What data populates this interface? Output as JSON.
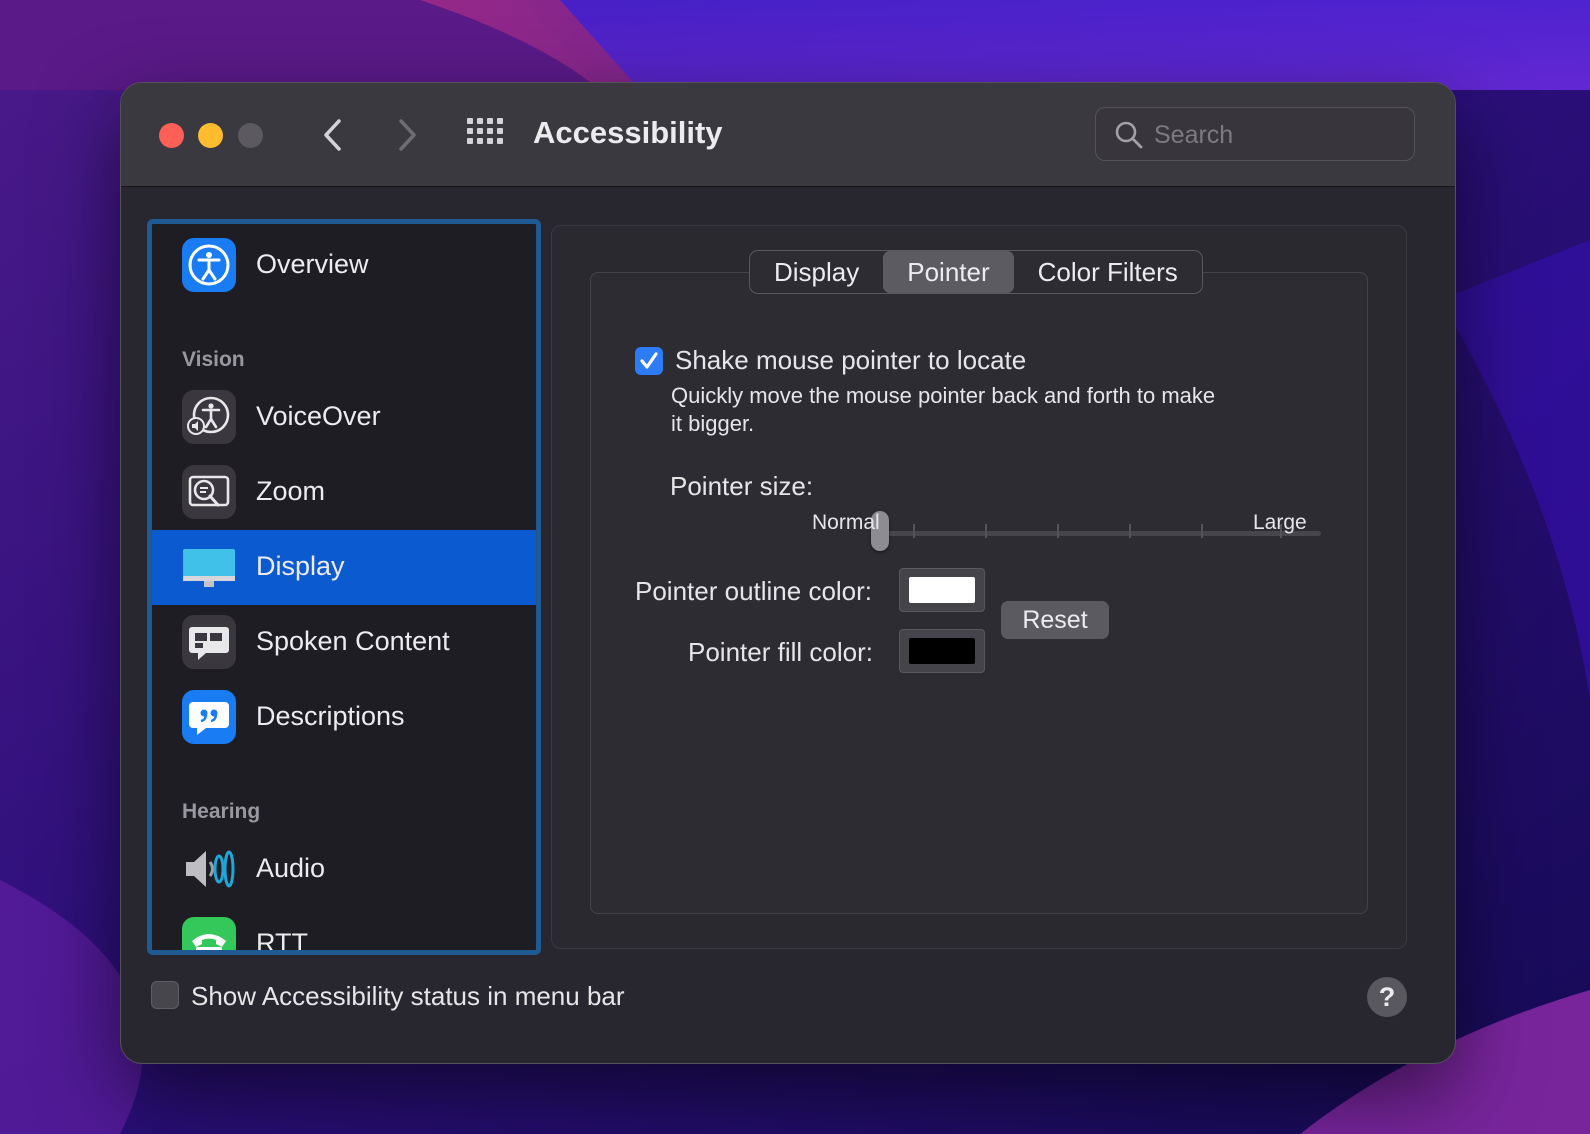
{
  "window": {
    "title": "Accessibility",
    "search_placeholder": "Search"
  },
  "sidebar": {
    "items": [
      {
        "label": "Overview",
        "icon": "accessibility-person-icon"
      },
      {
        "label": "VoiceOver",
        "icon": "voiceover-icon"
      },
      {
        "label": "Zoom",
        "icon": "zoom-magnifier-icon"
      },
      {
        "label": "Display",
        "icon": "display-monitor-icon",
        "selected": true
      },
      {
        "label": "Spoken Content",
        "icon": "speech-bubble-icon"
      },
      {
        "label": "Descriptions",
        "icon": "quote-bubble-icon"
      },
      {
        "label": "Audio",
        "icon": "speaker-icon"
      },
      {
        "label": "RTT",
        "icon": "telephone-icon"
      }
    ],
    "sections": {
      "vision": "Vision",
      "hearing": "Hearing"
    }
  },
  "tabs": [
    {
      "label": "Display",
      "active": false
    },
    {
      "label": "Pointer",
      "active": true
    },
    {
      "label": "Color Filters",
      "active": false
    }
  ],
  "pointer": {
    "shake_checkbox": {
      "label": "Shake mouse pointer to locate",
      "checked": true
    },
    "shake_description_line1": "Quickly move the mouse pointer back and forth to make",
    "shake_description_line2": "it bigger.",
    "size_label": "Pointer size:",
    "size_min_label": "Normal",
    "size_max_label": "Large",
    "size_value": 0,
    "outline_label": "Pointer outline color:",
    "outline_color": "#ffffff",
    "fill_label": "Pointer fill color:",
    "fill_color": "#000000",
    "reset_label": "Reset"
  },
  "footer": {
    "status_checkbox": {
      "label": "Show Accessibility status in menu bar",
      "checked": false
    },
    "help_label": "?"
  },
  "colors": {
    "accent": "#2d7cf6",
    "selection": "#0b5ad0",
    "close": "#fe5f57",
    "minimize": "#febc2e"
  }
}
